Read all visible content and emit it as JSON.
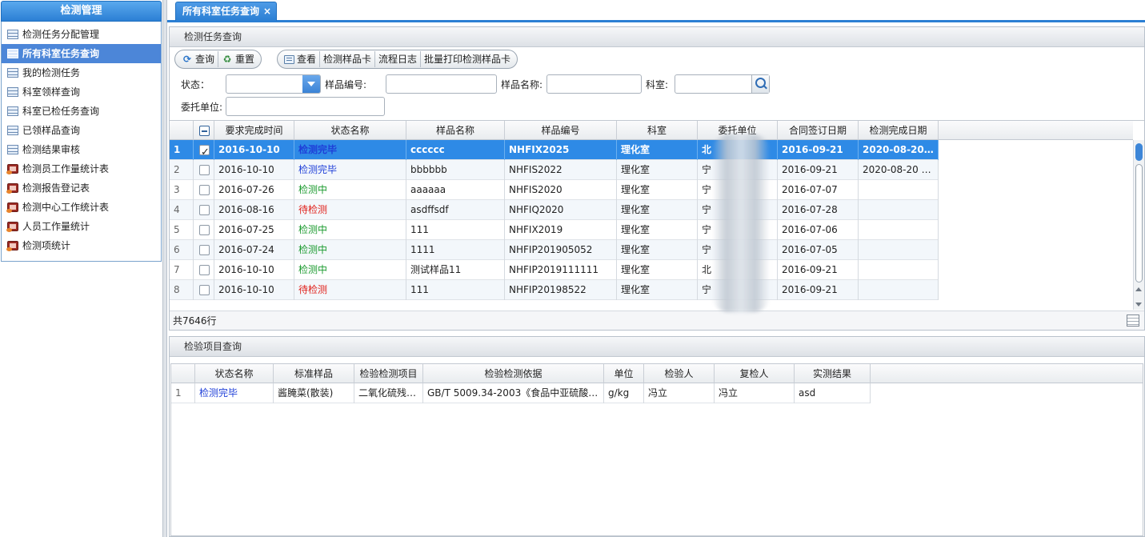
{
  "sidebar": {
    "title": "检测管理",
    "items": [
      {
        "label": "检测任务分配管理",
        "icon": "table-icon"
      },
      {
        "label": "所有科室任务查询",
        "icon": "table-icon",
        "active": true
      },
      {
        "label": "我的检测任务",
        "icon": "table-icon"
      },
      {
        "label": "科室领样查询",
        "icon": "table-icon"
      },
      {
        "label": "科室已检任务查询",
        "icon": "table-icon"
      },
      {
        "label": "已领样品查询",
        "icon": "table-icon"
      },
      {
        "label": "检测结果审核",
        "icon": "table-icon"
      },
      {
        "label": "检测员工作量统计表",
        "icon": "report-icon"
      },
      {
        "label": "检测报告登记表",
        "icon": "report-icon"
      },
      {
        "label": "检测中心工作统计表",
        "icon": "report-icon"
      },
      {
        "label": "人员工作量统计",
        "icon": "report-icon"
      },
      {
        "label": "检测项统计",
        "icon": "report-icon"
      }
    ]
  },
  "tabs": [
    {
      "label": "所有科室任务查询",
      "close": "×",
      "active": true
    }
  ],
  "task_panel": {
    "title": "检测任务查询",
    "toolbar_left": {
      "query": "查询",
      "reset": "重置"
    },
    "toolbar_right": {
      "view": "查看",
      "sample_card": "检测样品卡",
      "flow_log": "流程日志",
      "batch_print": "批量打印检测样品卡"
    },
    "filters": {
      "status_label": "状态：",
      "status_value": "",
      "sample_no_label": "样品编号:",
      "sample_no_value": "",
      "sample_name_label": "样品名称:",
      "sample_name_value": "",
      "dept_label": "科室:",
      "dept_value": "",
      "client_label": "委托单位:",
      "client_value": ""
    },
    "columns": [
      "要求完成时间",
      "状态名称",
      "样品名称",
      "样品编号",
      "科室",
      "委托单位",
      "合同签订日期",
      "检测完成日期"
    ],
    "rows": [
      {
        "no": "1",
        "checked": true,
        "due": "2016-10-10",
        "status": "检测完毕",
        "status_type": "done",
        "name": "cccccc",
        "code": "NHFIX2025",
        "dept": "理化室",
        "client": "北",
        "contract": "2016-09-21",
        "finish": "2020-08-20 1..."
      },
      {
        "no": "2",
        "checked": false,
        "due": "2016-10-10",
        "status": "检测完毕",
        "status_type": "done",
        "name": "bbbbbb",
        "code": "NHFIS2022",
        "dept": "理化室",
        "client": "宁",
        "contract": "2016-09-21",
        "finish": "2020-08-20 1..."
      },
      {
        "no": "3",
        "checked": false,
        "due": "2016-07-26",
        "status": "检测中",
        "status_type": "doing",
        "name": "aaaaaa",
        "code": "NHFIS2020",
        "dept": "理化室",
        "client": "宁",
        "contract": "2016-07-07",
        "finish": ""
      },
      {
        "no": "4",
        "checked": false,
        "due": "2016-08-16",
        "status": "待检测",
        "status_type": "wait",
        "name": "asdffsdf",
        "code": "NHFIQ2020",
        "dept": "理化室",
        "client": "宁",
        "contract": "2016-07-28",
        "finish": ""
      },
      {
        "no": "5",
        "checked": false,
        "due": "2016-07-25",
        "status": "检测中",
        "status_type": "doing",
        "name": "111",
        "code": "NHFIX2019",
        "dept": "理化室",
        "client": "宁",
        "contract": "2016-07-06",
        "finish": ""
      },
      {
        "no": "6",
        "checked": false,
        "due": "2016-07-24",
        "status": "检测中",
        "status_type": "doing",
        "name": "1111",
        "code": "NHFIP201905052",
        "dept": "理化室",
        "client": "宁",
        "contract": "2016-07-05",
        "finish": ""
      },
      {
        "no": "7",
        "checked": false,
        "due": "2016-10-10",
        "status": "检测中",
        "status_type": "doing",
        "name": "测试样品11",
        "code": "NHFIP2019111111",
        "dept": "理化室",
        "client": "北",
        "contract": "2016-09-21",
        "finish": ""
      },
      {
        "no": "8",
        "checked": false,
        "due": "2016-10-10",
        "status": "待检测",
        "status_type": "wait",
        "name": "111",
        "code": "NHFIP20198522",
        "dept": "理化室",
        "client": "宁",
        "contract": "2016-09-21",
        "finish": ""
      }
    ],
    "total": "共7646行"
  },
  "items_panel": {
    "title": "检验项目查询",
    "columns": [
      "状态名称",
      "标准样品",
      "检验检测项目",
      "检验检测依据",
      "单位",
      "检验人",
      "复检人",
      "实测结果"
    ],
    "rows": [
      {
        "no": "1",
        "status": "检测完毕",
        "std": "酱腌菜(散装)",
        "item": "二氧化硫残…",
        "basis": "GB/T 5009.34-2003《食品中亚硫酸盐…",
        "unit": "g/kg",
        "tester": "冯立",
        "rechecker": "冯立",
        "result": "asd"
      }
    ]
  },
  "colors": {
    "accent": "#2b7fd4",
    "selected_row": "#2e8ae6",
    "status_done": "#1f3fd8",
    "status_doing": "#1a9a2e",
    "status_wait": "#e0211b"
  }
}
